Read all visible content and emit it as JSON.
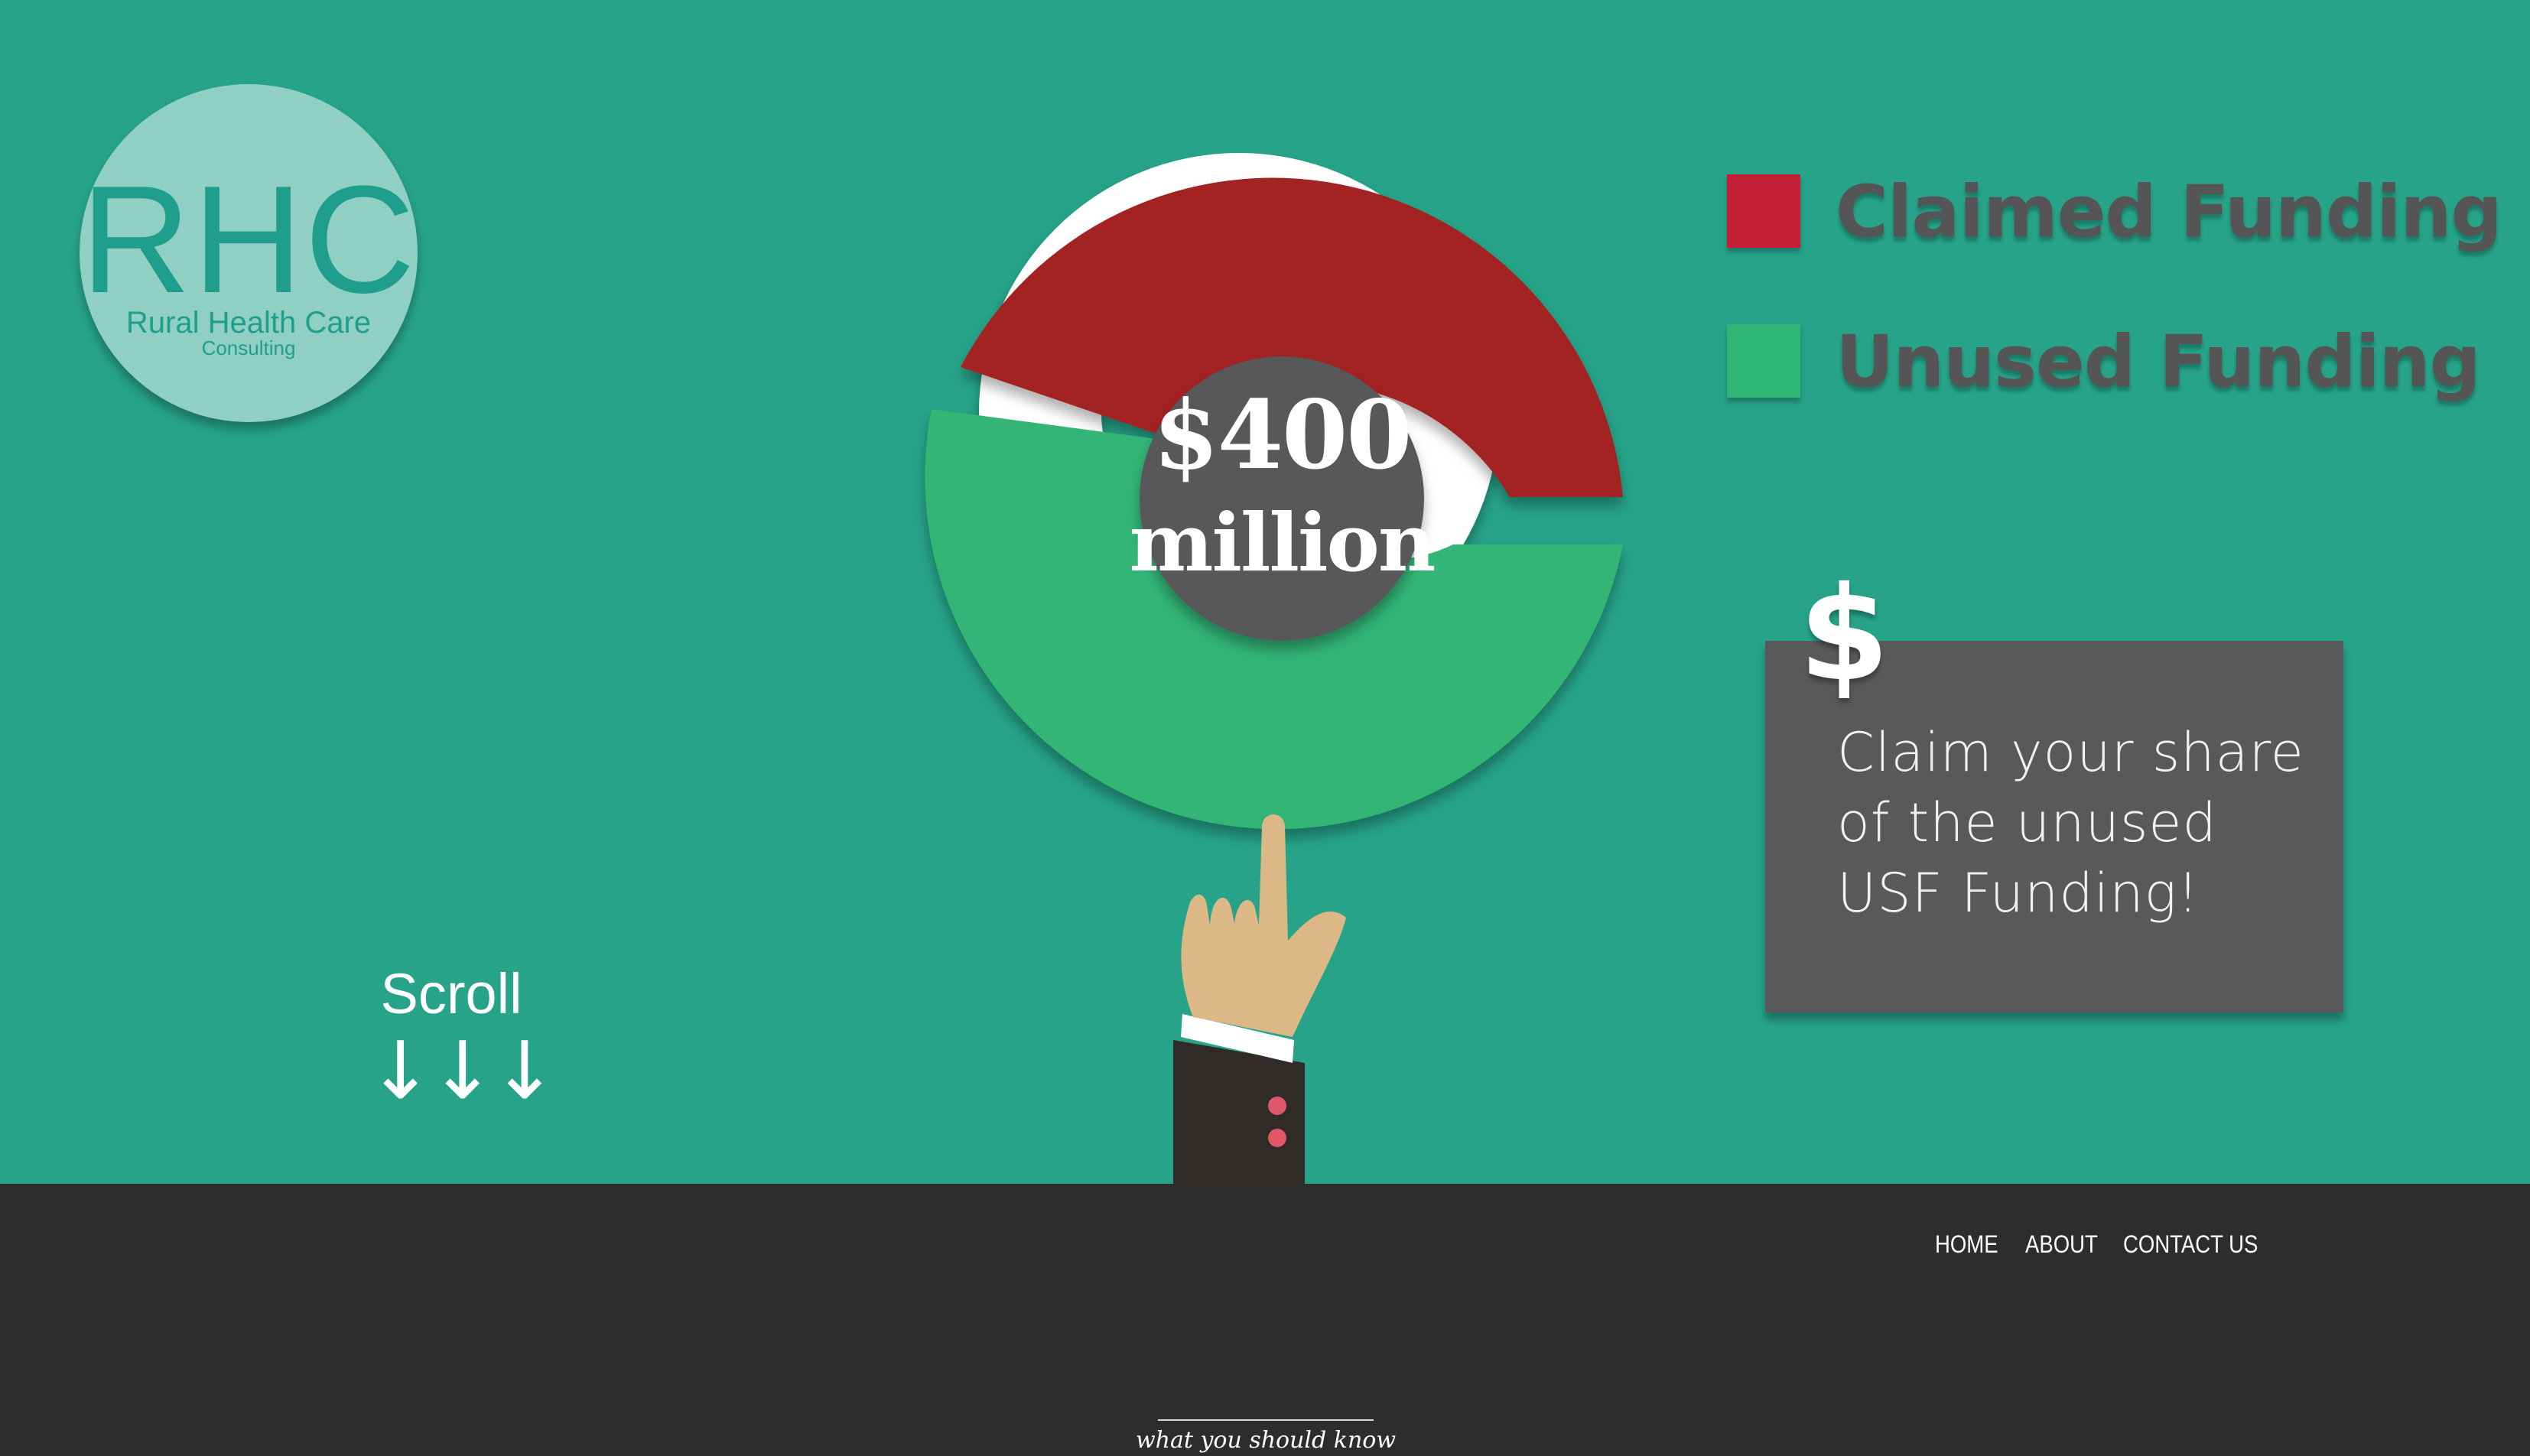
{
  "logo": {
    "initials": "RHC",
    "name": "Rural Health Care",
    "subtitle": "Consulting"
  },
  "chart_data": {
    "type": "pie",
    "center_label": [
      "$400",
      "million"
    ],
    "legend": [
      {
        "label": "Claimed Funding",
        "color": "#c41f35"
      },
      {
        "label": "Unused Funding",
        "color": "#2fb574"
      }
    ],
    "slice_colors": {
      "claimed": "#a32323",
      "unused": "#31b574",
      "separator": "#ffffff"
    }
  },
  "callout": {
    "icon": "dollar-icon",
    "symbol": "$",
    "lines": [
      "Claim your share",
      "of the unused",
      "USF Funding!"
    ]
  },
  "scroll": {
    "label": "Scroll",
    "arrows": "↓↓↓"
  },
  "nav": {
    "items": [
      "HOME",
      "ABOUT",
      "CONTACT US"
    ]
  },
  "section": {
    "tagline": "what you should know"
  },
  "colors": {
    "hero_bg": "#26a389",
    "footer_bg": "#2d2d2d",
    "callout_bg": "#59595b",
    "center_bg": "#58585a"
  }
}
